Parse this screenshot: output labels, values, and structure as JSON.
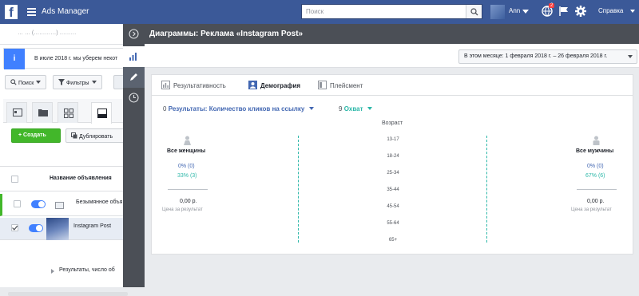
{
  "topbar": {
    "logo": "f",
    "app_title": "Ads Manager",
    "search_placeholder": "Поиск",
    "user_name": "Ann",
    "notification_count": "2",
    "help_label": "Справка"
  },
  "background": {
    "account_text": "…  …  (…………)  ………",
    "notice_text": "В июле 2018 г. мы уберем некот",
    "filters": {
      "search": "Поиск",
      "filters": "Фильтры"
    },
    "create_label": "Создать",
    "duplicate_label": "Дублировать",
    "column_header": "Название объявления",
    "rows": [
      {
        "name": "Безымянное объя"
      },
      {
        "name": "Instagram Post"
      }
    ],
    "results_text": "Результаты, число об"
  },
  "overlay": {
    "title": "Диаграммы: Реклама «Instagram Post»",
    "date_range": "В этом месяце: 1 февраля 2018 г. – 26 февраля 2018 г.",
    "tabs": [
      {
        "label": "Результативность"
      },
      {
        "label": "Демография"
      },
      {
        "label": "Плейсмент"
      }
    ],
    "metric1": {
      "value": "0",
      "label": "Результаты: Количество кликов на ссылку"
    },
    "metric2": {
      "value": "9",
      "label": "Охват"
    },
    "age_title": "Возраст",
    "age_groups": [
      "13-17",
      "18-24",
      "25-34",
      "35-44",
      "45-54",
      "55-64",
      "65+"
    ],
    "women": {
      "label": "Все женщины",
      "results_pct": "0% (0)",
      "reach_pct": "33% (3)",
      "cost": "0,00 р.",
      "cost_label": "Цена за результат"
    },
    "men": {
      "label": "Все мужчины",
      "results_pct": "0% (0)",
      "reach_pct": "67% (6)",
      "cost": "0,00 р.",
      "cost_label": "Цена за результат"
    }
  },
  "colors": {
    "brand": "#3b5998",
    "results_blue": "#4267b2",
    "reach_teal": "#2bb7a8",
    "create_green": "#42b72a"
  }
}
